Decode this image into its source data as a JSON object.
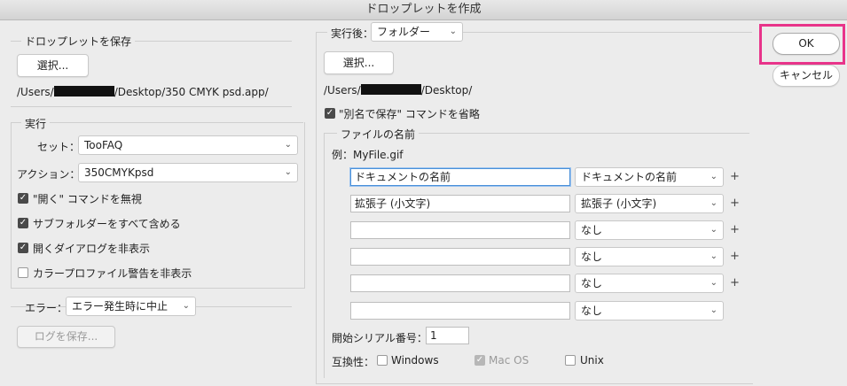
{
  "window": {
    "title": "ドロップレットを作成"
  },
  "save_droplet": {
    "legend": "ドロップレットを保存",
    "select_button": "選択...",
    "path_prefix": "/Users/",
    "path_suffix": "/Desktop/350 CMYK psd.app/"
  },
  "execute": {
    "legend": "実行",
    "set_label": "セット：",
    "set_value": "TooFAQ",
    "action_label": "アクション：",
    "action_value": "350CMYKpsd",
    "options": [
      {
        "label": "\"開く\" コマンドを無視",
        "checked": true
      },
      {
        "label": "サブフォルダーをすべて含める",
        "checked": true
      },
      {
        "label": "開くダイアログを非表示",
        "checked": true
      },
      {
        "label": "カラープロファイル警告を非表示",
        "checked": false
      }
    ]
  },
  "error": {
    "label": "エラー：",
    "value": "エラー発生時に中止",
    "save_log_button": "ログを保存..."
  },
  "after_run": {
    "label": "実行後：",
    "value": "フォルダー",
    "select_button": "選択...",
    "path_prefix": "/Users/",
    "path_suffix": "/Desktop/",
    "omit_save_as": {
      "label": "\"別名で保存\" コマンドを省略",
      "checked": true
    }
  },
  "file_naming": {
    "legend": "ファイルの名前",
    "example": "例：MyFile.gif",
    "rows": [
      {
        "text": "ドキュメントの名前",
        "option": "ドキュメントの名前",
        "plus": "+"
      },
      {
        "text": "拡張子 (小文字)",
        "option": "拡張子 (小文字)",
        "plus": "+"
      },
      {
        "text": "",
        "option": "なし",
        "plus": "+"
      },
      {
        "text": "",
        "option": "なし",
        "plus": "+"
      },
      {
        "text": "",
        "option": "なし",
        "plus": "+"
      },
      {
        "text": "",
        "option": "なし",
        "plus": ""
      }
    ],
    "serial_label": "開始シリアル番号：",
    "serial_value": "1",
    "compat_label": "互換性：",
    "compat": [
      {
        "label": "Windows",
        "checked": false,
        "disabled": false
      },
      {
        "label": "Mac OS",
        "checked": true,
        "disabled": true
      },
      {
        "label": "Unix",
        "checked": false,
        "disabled": false
      }
    ]
  },
  "buttons": {
    "ok": "OK",
    "cancel": "キャンセル"
  },
  "icons": {
    "chevron": "chevron-down-icon",
    "check": "checkmark-icon"
  },
  "colors": {
    "highlight": "#e8348a",
    "focus": "#4a90d9"
  }
}
